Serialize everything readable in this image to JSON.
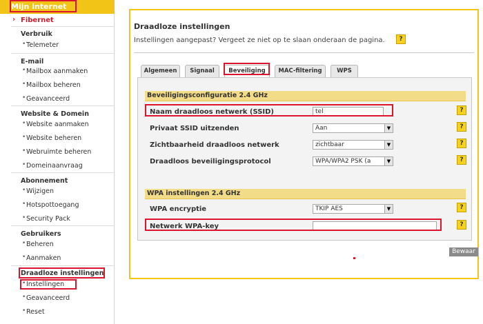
{
  "sidebar": {
    "header": "Mijn internet",
    "fibernet": "Fibernet",
    "groups": [
      {
        "title": "Verbruik",
        "items": [
          "Telemeter"
        ]
      },
      {
        "title": "E-mail",
        "items": [
          "Mailbox aanmaken",
          "Mailbox beheren",
          "Geavanceerd"
        ]
      },
      {
        "title": "Website & Domein",
        "items": [
          "Website aanmaken",
          "Website beheren",
          "Webruimte beheren",
          "Domeinaanvraag"
        ]
      },
      {
        "title": "Abonnement",
        "items": [
          "Wijzigen",
          "Hotspottoegang",
          "Security Pack"
        ]
      },
      {
        "title": "Gebruikers",
        "items": [
          "Beheren",
          "Aanmaken"
        ]
      },
      {
        "title": "Draadloze instellingen",
        "items": [
          "Instellingen",
          "Geavanceerd",
          "Reset"
        ]
      }
    ]
  },
  "main": {
    "title": "Draadloze instellingen",
    "subtitle": "Instellingen aangepast? Vergeet ze niet op te slaan onderaan de pagina.",
    "help_label": "?",
    "tabs": [
      {
        "label": "Algemeen",
        "active": false
      },
      {
        "label": "Signaal",
        "active": false
      },
      {
        "label": "Beveiliging",
        "active": true
      },
      {
        "label": "MAC-filtering",
        "active": false
      },
      {
        "label": "WPS",
        "active": false
      }
    ],
    "section1": {
      "title": "Beveiligingsconfiguratie 2.4 GHz",
      "rows": [
        {
          "label": "Naam draadloos netwerk (SSID)",
          "value": "tel"
        },
        {
          "label": "Privaat SSID uitzenden",
          "value": "Aan"
        },
        {
          "label": "Zichtbaarheid draadloos netwerk",
          "value": "zichtbaar"
        },
        {
          "label": "Draadloos beveiligingsprotocol",
          "value": "WPA/WPA2 PSK (a"
        }
      ]
    },
    "section2": {
      "title": "WPA instellingen 2.4 GHz",
      "rows": [
        {
          "label": "WPA encryptie",
          "value": "TKIP AES"
        },
        {
          "label": "Netwerk WPA-key",
          "value": ""
        }
      ]
    },
    "save_label": "Bewaar"
  },
  "colors": {
    "accent_yellow": "#f2c418",
    "section_bg": "#f2dc88",
    "highlight_red": "#d9142c",
    "link_red": "#cc1f2f"
  }
}
